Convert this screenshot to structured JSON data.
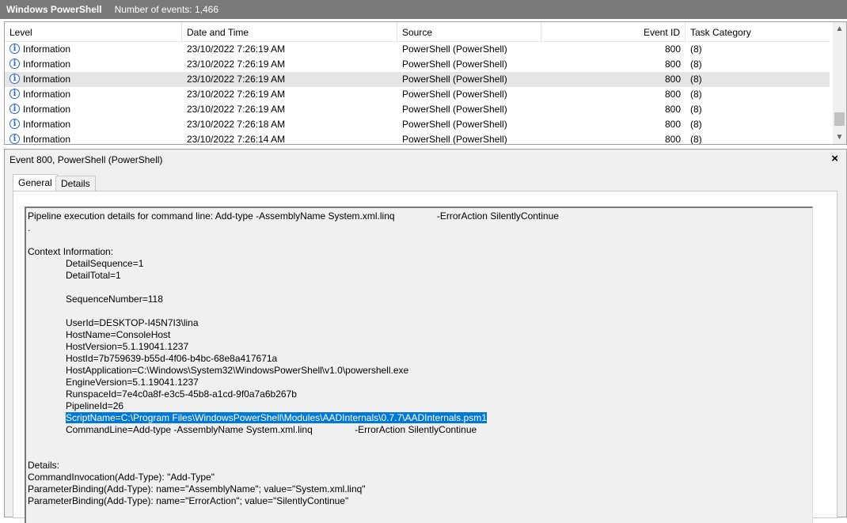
{
  "titlebar": {
    "app": "Windows PowerShell",
    "count": "Number of events: 1,466"
  },
  "list": {
    "columns": [
      "Level",
      "Date and Time",
      "Source",
      "Event ID",
      "Task Category"
    ],
    "rows": [
      {
        "level": "Information",
        "datetime": "23/10/2022 7:26:19 AM",
        "source": "PowerShell (PowerShell)",
        "event_id": "800",
        "task": "(8)"
      },
      {
        "level": "Information",
        "datetime": "23/10/2022 7:26:19 AM",
        "source": "PowerShell (PowerShell)",
        "event_id": "800",
        "task": "(8)"
      },
      {
        "level": "Information",
        "datetime": "23/10/2022 7:26:19 AM",
        "source": "PowerShell (PowerShell)",
        "event_id": "800",
        "task": "(8)"
      },
      {
        "level": "Information",
        "datetime": "23/10/2022 7:26:19 AM",
        "source": "PowerShell (PowerShell)",
        "event_id": "800",
        "task": "(8)"
      },
      {
        "level": "Information",
        "datetime": "23/10/2022 7:26:19 AM",
        "source": "PowerShell (PowerShell)",
        "event_id": "800",
        "task": "(8)"
      },
      {
        "level": "Information",
        "datetime": "23/10/2022 7:26:18 AM",
        "source": "PowerShell (PowerShell)",
        "event_id": "800",
        "task": "(8)"
      },
      {
        "level": "Information",
        "datetime": "23/10/2022 7:26:14 AM",
        "source": "PowerShell (PowerShell)",
        "event_id": "800",
        "task": "(8)"
      }
    ],
    "selected_row": 2
  },
  "detail": {
    "title": "Event 800, PowerShell (PowerShell)",
    "close": "×",
    "tabs": [
      "General",
      "Details"
    ],
    "lines": [
      "Pipeline execution details for command line: Add-type -AssemblyName System.xml.linq                -ErrorAction SilentlyContinue",
      ".",
      "",
      "Context Information:",
      "DetailSequence=1",
      "DetailTotal=1",
      "",
      "SequenceNumber=118",
      "",
      "UserId=DESKTOP-I45N7I3\\lina",
      "HostName=ConsoleHost",
      "HostVersion=5.1.19041.1237",
      "HostId=7b759639-b55d-4f06-b4bc-68e8a417671a",
      "HostApplication=C:\\Windows\\System32\\WindowsPowerShell\\v1.0\\powershell.exe",
      "EngineVersion=5.1.19041.1237",
      "RunspaceId=7e4c0a8f-e3c5-45b8-a1cd-9f0a7a6b267b",
      "PipelineId=26",
      "ScriptName=C:\\Program Files\\WindowsPowerShell\\Modules\\AADInternals\\0.7.7\\AADInternals.psm1",
      "CommandLine=Add-type -AssemblyName System.xml.linq                -ErrorAction SilentlyContinue",
      "",
      "",
      "Details:",
      "CommandInvocation(Add-Type): \"Add-Type\"",
      "ParameterBinding(Add-Type): name=\"AssemblyName\"; value=\"System.xml.linq\"",
      "ParameterBinding(Add-Type): name=\"ErrorAction\"; value=\"SilentlyContinue\""
    ],
    "indented_lines": [
      4,
      5,
      7,
      9,
      10,
      11,
      12,
      13,
      14,
      15,
      16,
      17,
      18
    ],
    "highlighted_line": 17
  },
  "icons": {
    "info": "information-icon",
    "close": "close-icon"
  },
  "colors": {
    "titlebar": "#7a7a7a",
    "selection": "#0078d7",
    "row_selected": "#e5e5e5"
  }
}
